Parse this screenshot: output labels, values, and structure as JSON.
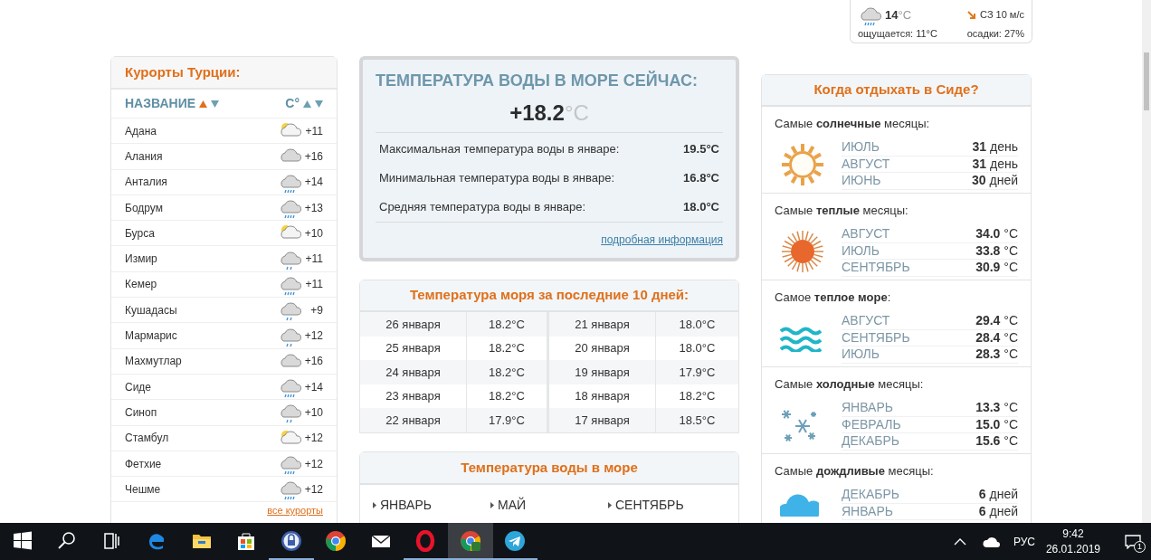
{
  "weather_widget": {
    "kind": "rain",
    "temp": "14",
    "unit": "°C",
    "wind": "СЗ 10 м/с",
    "feels": "ощущается: 11°C",
    "precip": "осадки: 27%"
  },
  "resorts": {
    "title": "Курорты Турции:",
    "columns": [
      {
        "label": "НАЗВАНИЕ",
        "sorted": true
      },
      {
        "label": "C°",
        "sorted": false
      }
    ],
    "rows": [
      {
        "name": "Адана",
        "kind": "partly",
        "temp": "+11"
      },
      {
        "name": "Алания",
        "kind": "cloud",
        "temp": "+16"
      },
      {
        "name": "Анталия",
        "kind": "rain",
        "temp": "+14"
      },
      {
        "name": "Бодрум",
        "kind": "rain",
        "temp": "+13"
      },
      {
        "name": "Бурса",
        "kind": "partly",
        "temp": "+10"
      },
      {
        "name": "Измир",
        "kind": "drizzle",
        "temp": "+11"
      },
      {
        "name": "Кемер",
        "kind": "rain",
        "temp": "+11"
      },
      {
        "name": "Кушадасы",
        "kind": "drizzle",
        "temp": "+9"
      },
      {
        "name": "Мармарис",
        "kind": "drizzle",
        "temp": "+12"
      },
      {
        "name": "Махмутлар",
        "kind": "cloud",
        "temp": "+16"
      },
      {
        "name": "Сиде",
        "kind": "rain",
        "temp": "+14"
      },
      {
        "name": "Синоп",
        "kind": "drizzle",
        "temp": "+10"
      },
      {
        "name": "Стамбул",
        "kind": "partly",
        "temp": "+12"
      },
      {
        "name": "Фетхие",
        "kind": "rain",
        "temp": "+12"
      },
      {
        "name": "Чешме",
        "kind": "rain",
        "temp": "+12"
      }
    ],
    "more_link": "все курорты"
  },
  "water_now": {
    "title": "ТЕМПЕРАТУРА ВОДЫ В МОРЕ СЕЙЧАС:",
    "value": "+18.2",
    "unit": "°C",
    "stats": [
      {
        "label": "Максимальная температура воды в январе:",
        "value": "19.5°C"
      },
      {
        "label": "Минимальная температура воды в январе:",
        "value": "16.8°C"
      },
      {
        "label": "Средняя температура воды в январе:",
        "value": "18.0°C"
      }
    ],
    "link": "подробная информация"
  },
  "last_days": {
    "title": "Температура моря за последние 10 дней:",
    "rows": [
      [
        {
          "date": "26 января",
          "temp": "18.2°C"
        },
        {
          "date": "21 января",
          "temp": "18.0°C"
        }
      ],
      [
        {
          "date": "25 января",
          "temp": "18.2°C"
        },
        {
          "date": "20 января",
          "temp": "18.0°C"
        }
      ],
      [
        {
          "date": "24 января",
          "temp": "18.2°C"
        },
        {
          "date": "19 января",
          "temp": "17.9°C"
        }
      ],
      [
        {
          "date": "23 января",
          "temp": "18.2°C"
        },
        {
          "date": "18 января",
          "temp": "18.2°C"
        }
      ],
      [
        {
          "date": "22 января",
          "temp": "17.9°C"
        },
        {
          "date": "17 января",
          "temp": "18.5°C"
        }
      ]
    ]
  },
  "months_card": {
    "title": "Температура воды в море",
    "months": [
      "ЯНВАРЬ",
      "МАЙ",
      "СЕНТЯБРЬ"
    ]
  },
  "when_card": {
    "title": "Когда отдыхать в Сиде?",
    "sections": [
      {
        "title": "Самые **солнечные** месяцы:",
        "kind": "sun",
        "rows": [
          {
            "month": "ИЮЛЬ",
            "value": "**31** день"
          },
          {
            "month": "АВГУСТ",
            "value": "**31** день"
          },
          {
            "month": "ИЮНЬ",
            "value": "**30** дней"
          }
        ]
      },
      {
        "title": "Самые **теплые** месяцы:",
        "kind": "hot",
        "rows": [
          {
            "month": "АВГУСТ",
            "value": "**34.0** °C"
          },
          {
            "month": "ИЮЛЬ",
            "value": "**33.8** °C"
          },
          {
            "month": "СЕНТЯБРЬ",
            "value": "**30.9** °C"
          }
        ]
      },
      {
        "title": "Самое **теплое море**:",
        "kind": "waves",
        "rows": [
          {
            "month": "АВГУСТ",
            "value": "**29.4** °C"
          },
          {
            "month": "СЕНТЯБРЬ",
            "value": "**28.4** °C"
          },
          {
            "month": "ИЮЛЬ",
            "value": "**28.3** °C"
          }
        ]
      },
      {
        "title": "Самые **холодные** месяцы:",
        "kind": "snow",
        "rows": [
          {
            "month": "ЯНВАРЬ",
            "value": "**13.3** °C"
          },
          {
            "month": "ФЕВРАЛЬ",
            "value": "**15.0** °C"
          },
          {
            "month": "ДЕКАБРЬ",
            "value": "**15.6** °C"
          }
        ]
      },
      {
        "title": "Самые **дождливые** месяцы:",
        "kind": "rain",
        "rows": [
          {
            "month": "ДЕКАБРЬ",
            "value": "**6** дней"
          },
          {
            "month": "ЯНВАРЬ",
            "value": "**6** дней"
          }
        ]
      }
    ]
  },
  "taskbar": {
    "apps": [
      {
        "kind": "start",
        "open": false,
        "selected": false
      },
      {
        "kind": "search",
        "open": false,
        "selected": false
      },
      {
        "kind": "taskview",
        "open": false,
        "selected": false
      },
      {
        "kind": "edge",
        "open": false,
        "selected": false
      },
      {
        "kind": "folder",
        "open": false,
        "selected": false
      },
      {
        "kind": "store",
        "open": false,
        "selected": false
      },
      {
        "kind": "lock",
        "open": true,
        "selected": false
      },
      {
        "kind": "chrome",
        "open": false,
        "selected": false
      },
      {
        "kind": "mail",
        "open": false,
        "selected": false
      },
      {
        "kind": "opera",
        "open": true,
        "selected": false
      },
      {
        "kind": "chrome2",
        "open": true,
        "selected": true
      },
      {
        "kind": "telegram",
        "open": true,
        "selected": false
      }
    ],
    "language": "РУС",
    "time": "9:42",
    "date": "26.01.2019",
    "notifications": "1"
  }
}
